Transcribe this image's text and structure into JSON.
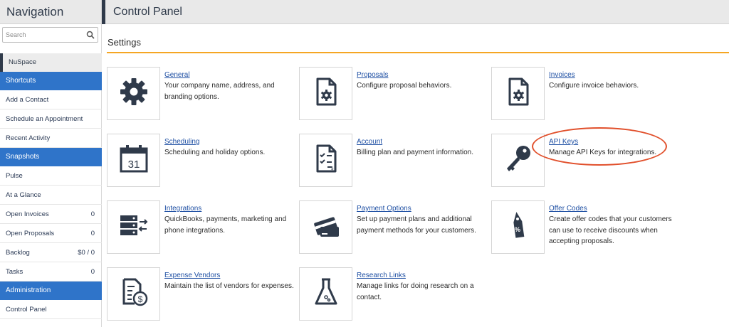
{
  "sidebar": {
    "title": "Navigation",
    "search_placeholder": "Search",
    "active_item": "NuSpace",
    "sections": [
      {
        "label": "Shortcuts",
        "items": [
          {
            "label": "Add a Contact",
            "count": ""
          },
          {
            "label": "Schedule an Appointment",
            "count": ""
          },
          {
            "label": "Recent Activity",
            "count": ""
          }
        ]
      },
      {
        "label": "Snapshots",
        "items": [
          {
            "label": "Pulse",
            "count": ""
          },
          {
            "label": "At a Glance",
            "count": ""
          },
          {
            "label": "Open Invoices",
            "count": "0"
          },
          {
            "label": "Open Proposals",
            "count": "0"
          },
          {
            "label": "Backlog",
            "count": "$0 / 0"
          },
          {
            "label": "Tasks",
            "count": "0"
          }
        ]
      },
      {
        "label": "Administration",
        "items": [
          {
            "label": "Control Panel",
            "count": ""
          }
        ]
      }
    ]
  },
  "header": {
    "title": "Control Panel"
  },
  "settings": {
    "title": "Settings",
    "accent_color": "#f5a623",
    "cards": [
      {
        "name": "general",
        "icon": "gear-icon",
        "link": "General",
        "desc": "Your company name, address, and branding options."
      },
      {
        "name": "proposals",
        "icon": "document-gear-icon",
        "link": "Proposals",
        "desc": "Configure proposal behaviors."
      },
      {
        "name": "invoices",
        "icon": "document-gear-icon",
        "link": "Invoices",
        "desc": "Configure invoice behaviors."
      },
      {
        "name": "scheduling",
        "icon": "calendar-icon",
        "link": "Scheduling",
        "desc": "Scheduling and holiday options."
      },
      {
        "name": "account",
        "icon": "billing-document-icon",
        "link": "Account",
        "desc": "Billing plan and payment information."
      },
      {
        "name": "api-keys",
        "icon": "key-icon",
        "link": "API Keys",
        "desc": "Manage API Keys for integrations."
      },
      {
        "name": "integrations",
        "icon": "server-exchange-icon",
        "link": "Integrations",
        "desc": "QuickBooks, payments, marketing and phone integrations."
      },
      {
        "name": "payment-options",
        "icon": "credit-card-icon",
        "link": "Payment Options",
        "desc": "Set up payment plans and additional payment methods for your customers."
      },
      {
        "name": "offer-codes",
        "icon": "price-tag-icon",
        "link": "Offer Codes",
        "desc": "Create offer codes that your customers can use to receive discounts when accepting proposals."
      },
      {
        "name": "expense-vendors",
        "icon": "expense-document-icon",
        "link": "Expense Vendors",
        "desc": "Maintain the list of vendors for expenses."
      },
      {
        "name": "research-links",
        "icon": "flask-icon",
        "link": "Research Links",
        "desc": "Manage links for doing research on a contact."
      }
    ]
  },
  "calendar_day": "31",
  "colors": {
    "nav_section": "#2f74c9",
    "link": "#1e4fa3",
    "icon": "#2f3a4a",
    "highlight": "#e1502c"
  }
}
